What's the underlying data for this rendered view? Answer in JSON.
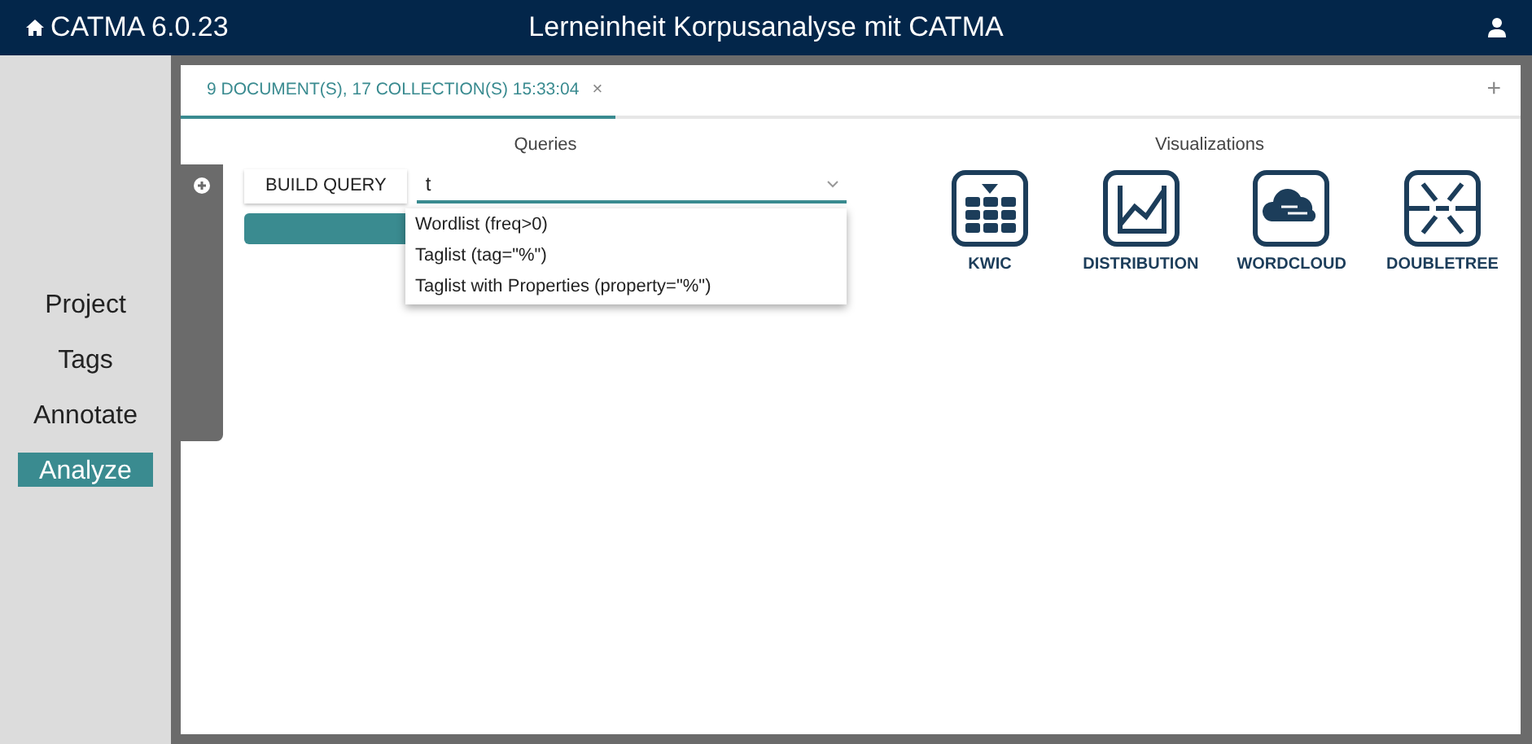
{
  "header": {
    "app_name": "CATMA 6.0.23",
    "title": "Lerneinheit Korpusanalyse mit CATMA"
  },
  "sidebar": {
    "items": [
      {
        "label": "Project",
        "selected": false
      },
      {
        "label": "Tags",
        "selected": false
      },
      {
        "label": "Annotate",
        "selected": false
      },
      {
        "label": "Analyze",
        "selected": true
      }
    ]
  },
  "tabs": [
    {
      "label": "9 DOCUMENT(S), 17 COLLECTION(S) 15:33:04",
      "selected": true,
      "close": "×"
    }
  ],
  "add_tab": "+",
  "queries": {
    "title": "Queries",
    "build_button": "BUILD QUERY",
    "query_field": {
      "value": "t"
    },
    "suggestions": [
      "Wordlist (freq>0)",
      "Taglist (tag=\"%\")",
      "Taglist with Properties (property=\"%\")"
    ]
  },
  "visualizations": {
    "title": "Visualizations",
    "items": [
      {
        "kind": "kwic",
        "label": "KWIC"
      },
      {
        "kind": "distribution",
        "label": "DISTRIBUTION"
      },
      {
        "kind": "wordcloud",
        "label": "WORDCLOUD"
      },
      {
        "kind": "doubletree",
        "label": "DOUBLETREE"
      }
    ]
  }
}
